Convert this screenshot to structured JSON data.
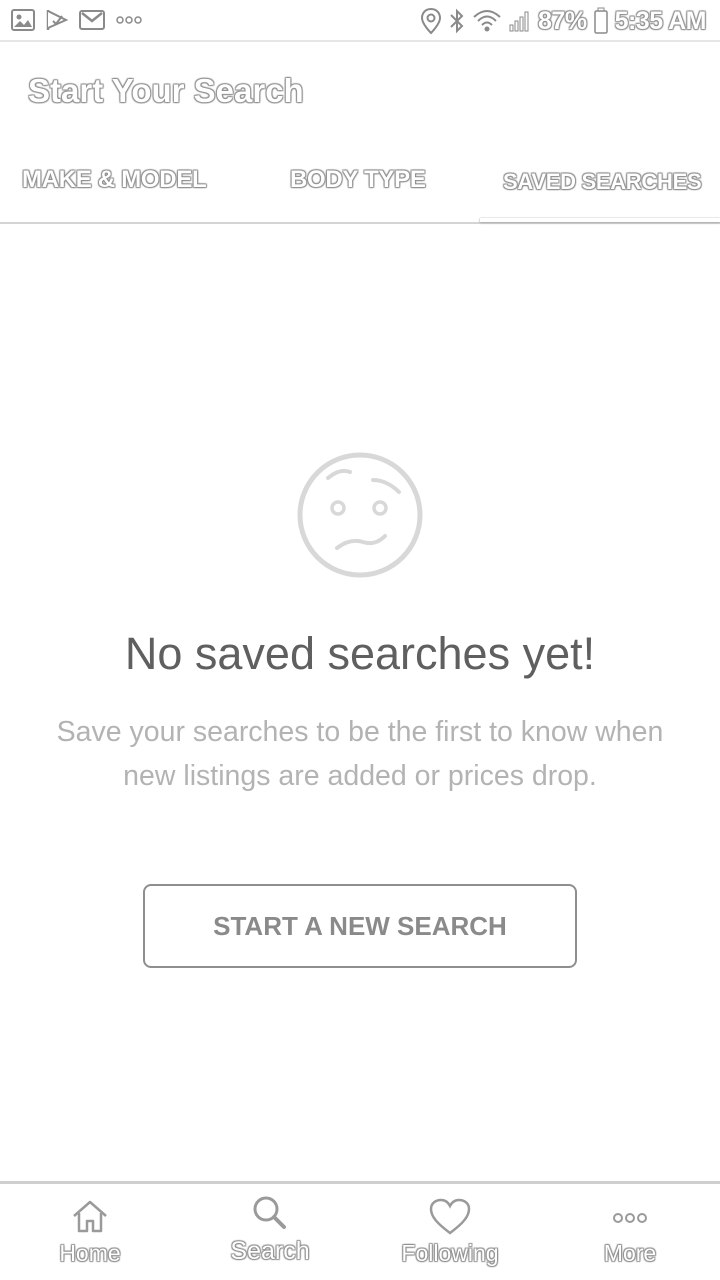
{
  "status_bar": {
    "battery": "87%",
    "time": "5:35 AM",
    "icons": [
      "image-icon",
      "flag-icon",
      "gmail-icon",
      "more-dots-icon",
      "location-icon",
      "bluetooth-icon",
      "wifi-icon",
      "signal-icon",
      "battery-icon"
    ]
  },
  "header": {
    "title": "Start Your Search"
  },
  "tabs": [
    {
      "label": "MAKE & MODEL",
      "selected": false
    },
    {
      "label": "BODY TYPE",
      "selected": false
    },
    {
      "label": "SAVED SEARCHES",
      "selected": true
    }
  ],
  "empty_state": {
    "icon": "confused-face-icon",
    "title": "No saved searches yet!",
    "description": "Save your searches to be the first to know when new listings are added or prices drop.",
    "button_label": "START A NEW SEARCH"
  },
  "bottom_nav": {
    "items": [
      {
        "label": "Home",
        "icon": "home-icon"
      },
      {
        "label": "Search",
        "icon": "search-icon",
        "active": true
      },
      {
        "label": "Following",
        "icon": "heart-icon"
      },
      {
        "label": "More",
        "icon": "more-dots-icon"
      }
    ]
  },
  "colors": {
    "background": "#ffffff",
    "title_text": "#5f5f5f",
    "muted_text": "#b3b3b3",
    "button_border": "#8f8f8f",
    "divider": "#d4d4d4"
  }
}
